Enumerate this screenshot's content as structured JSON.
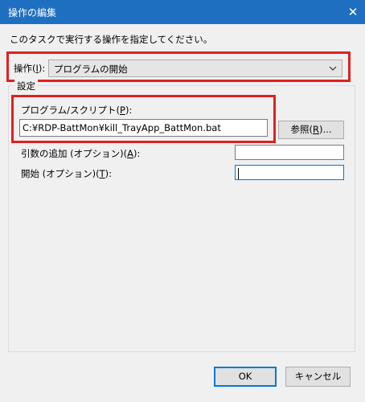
{
  "window": {
    "title": "操作の編集",
    "close_glyph": "✕"
  },
  "instruction": "このタスクで実行する操作を指定してください。",
  "action": {
    "label_prefix": "操作(",
    "label_key": "I",
    "label_suffix": "):",
    "selected_value": "プログラムの開始"
  },
  "settings": {
    "legend": "設定",
    "program": {
      "label_prefix": "プログラム/スクリプト(",
      "label_key": "P",
      "label_suffix": "):",
      "value": "C:¥RDP-BattMon¥kill_TrayApp_BattMon.bat"
    },
    "browse_button": {
      "prefix": "参照(",
      "key": "R",
      "suffix": ")..."
    },
    "arguments": {
      "label_prefix": "引数の追加 (オプション)(",
      "label_key": "A",
      "label_suffix": "):",
      "value": ""
    },
    "start_in": {
      "label_prefix": "開始 (オプション)(",
      "label_key": "T",
      "label_suffix": "):",
      "value": ""
    }
  },
  "buttons": {
    "ok": "OK",
    "cancel": "キャンセル"
  },
  "colors": {
    "titlebar": "#1f6fc0",
    "highlight": "#e02020",
    "focus": "#0078d7"
  },
  "icons": {
    "close": "close-icon",
    "dropdown": "chevron-down-icon"
  }
}
